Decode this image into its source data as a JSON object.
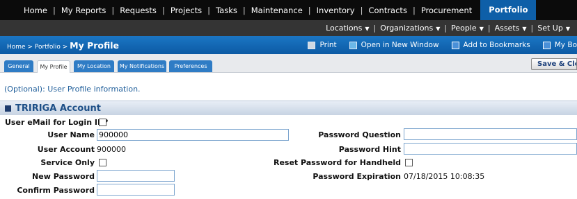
{
  "topnav": {
    "items": [
      "Home",
      "My Reports",
      "Requests",
      "Projects",
      "Tasks",
      "Maintenance",
      "Inventory",
      "Contracts",
      "Procurement"
    ],
    "active": "Portfolio"
  },
  "subnav": {
    "items": [
      "Locations",
      "Organizations",
      "People",
      "Assets",
      "Set Up"
    ]
  },
  "titlebar": {
    "breadcrumb": "Home > Portfolio > ",
    "page_title": "My Profile",
    "print": "Print",
    "open_window": "Open in New Window",
    "bookmarks": "Add to Bookmarks",
    "my_bookmarks": "My Bo"
  },
  "tabs": [
    "General",
    "My Profile",
    "My Location",
    "My Notifications",
    "Preferences"
  ],
  "save_close": "Save & Clos",
  "optional_text": "(Optional): User Profile information.",
  "section_title": "TRIRIGA Account",
  "form": {
    "email_login_label": "User eMail for Login ID?",
    "user_name_label": "User Name",
    "user_name_value": "900000",
    "user_account_label": "User Account",
    "user_account_value": "900000",
    "service_only_label": "Service Only",
    "new_password_label": "New Password",
    "confirm_password_label": "Confirm Password",
    "password_question_label": "Password Question",
    "password_hint_label": "Password Hint",
    "reset_password_label": "Reset Password for Handheld",
    "password_expiration_label": "Password Expiration",
    "password_expiration_value": "07/18/2015 10:08:35"
  }
}
